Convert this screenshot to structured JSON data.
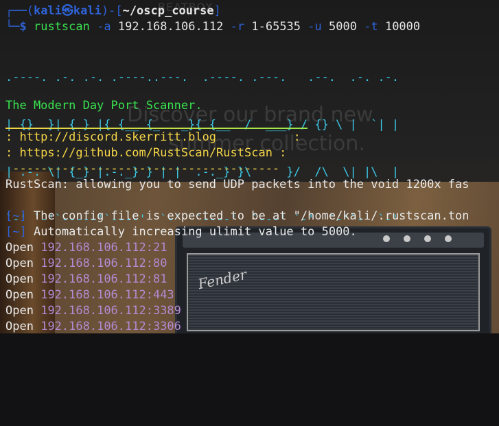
{
  "background_ads": {
    "brand": "BEATBOX",
    "line1": "Discover our brand new",
    "line2": "summer collection."
  },
  "amp_brand": "Fender",
  "prompt": {
    "box_top": "┌──(",
    "user": "kali",
    "at": "㉿",
    "host": "kali",
    "sep": ")-[",
    "path": "~/oscp_course",
    "close": "]",
    "box_bottom": "└─",
    "symbol": "$"
  },
  "command": {
    "program": "rustscan",
    "flag_a": "-a",
    "target": "192.168.106.112",
    "flag_r": "-r",
    "range": "1-65535",
    "flag_u": "-u",
    "ulimit": "5000",
    "flag_t": "-t",
    "timeout": "10000"
  },
  "banner": [
    ".----. .-. .-. .----..---.  .----. .---.   .--.  .-. .-.",
    "| {}  }| { } |{ {__ {_   _}{ {__  /  ___} / {} \\ |  `| |",
    "| .-. \\| {_} |.-._} } | |  .-._} }\\     }/  /\\  \\| |\\  |",
    "`-' `-'`-----'`----'  `-'  `----'  `---' `-'  `-'`-' `-'"
  ],
  "tagline": "The Modern Day Port Scanner.",
  "links": {
    "discord": ": http://discord.skerritt.blog           :",
    "github": ": https://github.com/RustScan/RustScan :",
    "dashes": " --------------------------------------"
  },
  "udp_note": "RustScan: allowing you to send UDP packets into the void 1200x fas",
  "info": [
    {
      "tag": "[~]",
      "text": "The config file is expected to be at \"/home/kali/.rustscan.ton"
    },
    {
      "tag": "[~]",
      "text": "Automatically increasing ulimit value to 5000."
    }
  ],
  "open_ports": [
    {
      "label": "Open",
      "addr": "192.168.106.112:21"
    },
    {
      "label": "Open",
      "addr": "192.168.106.112:80"
    },
    {
      "label": "Open",
      "addr": "192.168.106.112:81"
    },
    {
      "label": "Open",
      "addr": "192.168.106.112:443"
    },
    {
      "label": "Open",
      "addr": "192.168.106.112:3389"
    },
    {
      "label": "Open",
      "addr": "192.168.106.112:3306"
    }
  ],
  "colors": {
    "prompt_frame": "#2e63d8",
    "ip": "#b48ad3",
    "tagline": "#39e34f",
    "links": "#f5d547",
    "banner": "#3cc8e6"
  }
}
